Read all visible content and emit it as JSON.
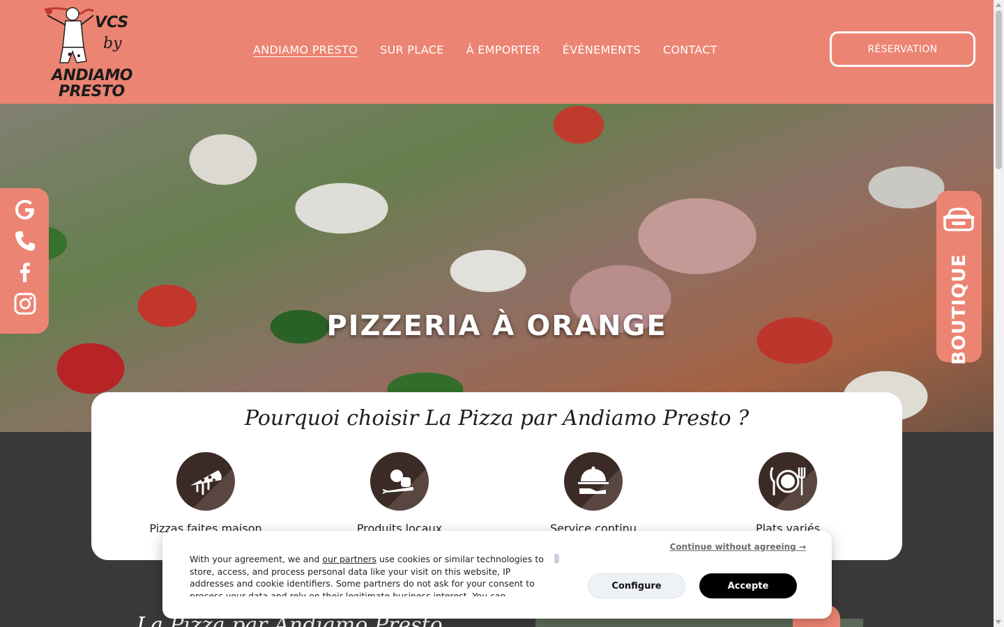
{
  "header": {
    "logo": {
      "top": "VCS",
      "middle": "by",
      "line1": "ANDIAMO",
      "line2": "PRESTO"
    },
    "nav": [
      {
        "label": "ANDIAMO PRESTO",
        "active": true
      },
      {
        "label": "SUR PLACE"
      },
      {
        "label": "À EMPORTER"
      },
      {
        "label": "ÉVÉNEMENTS"
      },
      {
        "label": "CONTACT"
      }
    ],
    "reservation_label": "RÉSERVATION",
    "bg_color": "#ec8473"
  },
  "hero": {
    "title": "PIZZERIA À ORANGE"
  },
  "social": [
    "google-icon",
    "phone-icon",
    "facebook-icon",
    "instagram-icon"
  ],
  "boutique": {
    "label": "BOUTIQUE",
    "icon": "takeaway-box-icon"
  },
  "features": {
    "title": "Pourquoi choisir La Pizza par Andiamo Presto ?",
    "items": [
      {
        "label": "Pizzas faites maison",
        "icon": "pizza-slice-icon"
      },
      {
        "label": "Produits locaux",
        "icon": "vegetables-icon"
      },
      {
        "label": "Service continu",
        "icon": "cloche-icon"
      },
      {
        "label": "Plats variés",
        "icon": "plate-cutlery-icon"
      }
    ]
  },
  "lower": {
    "title": "La Pizza par Andiamo Presto"
  },
  "cookie": {
    "skip_label": "Continue without agreeing →",
    "text_before": "With your agreement, we and ",
    "link_label": "our partners",
    "text_after": " use cookies or similar technologies to store, access, and process personal data like your visit on this website, IP addresses and cookie identifiers. Some partners do not ask for your consent to process your data and rely on their legitimate business interest. You can",
    "configure_label": "Configure",
    "accept_label": "Accepte"
  }
}
